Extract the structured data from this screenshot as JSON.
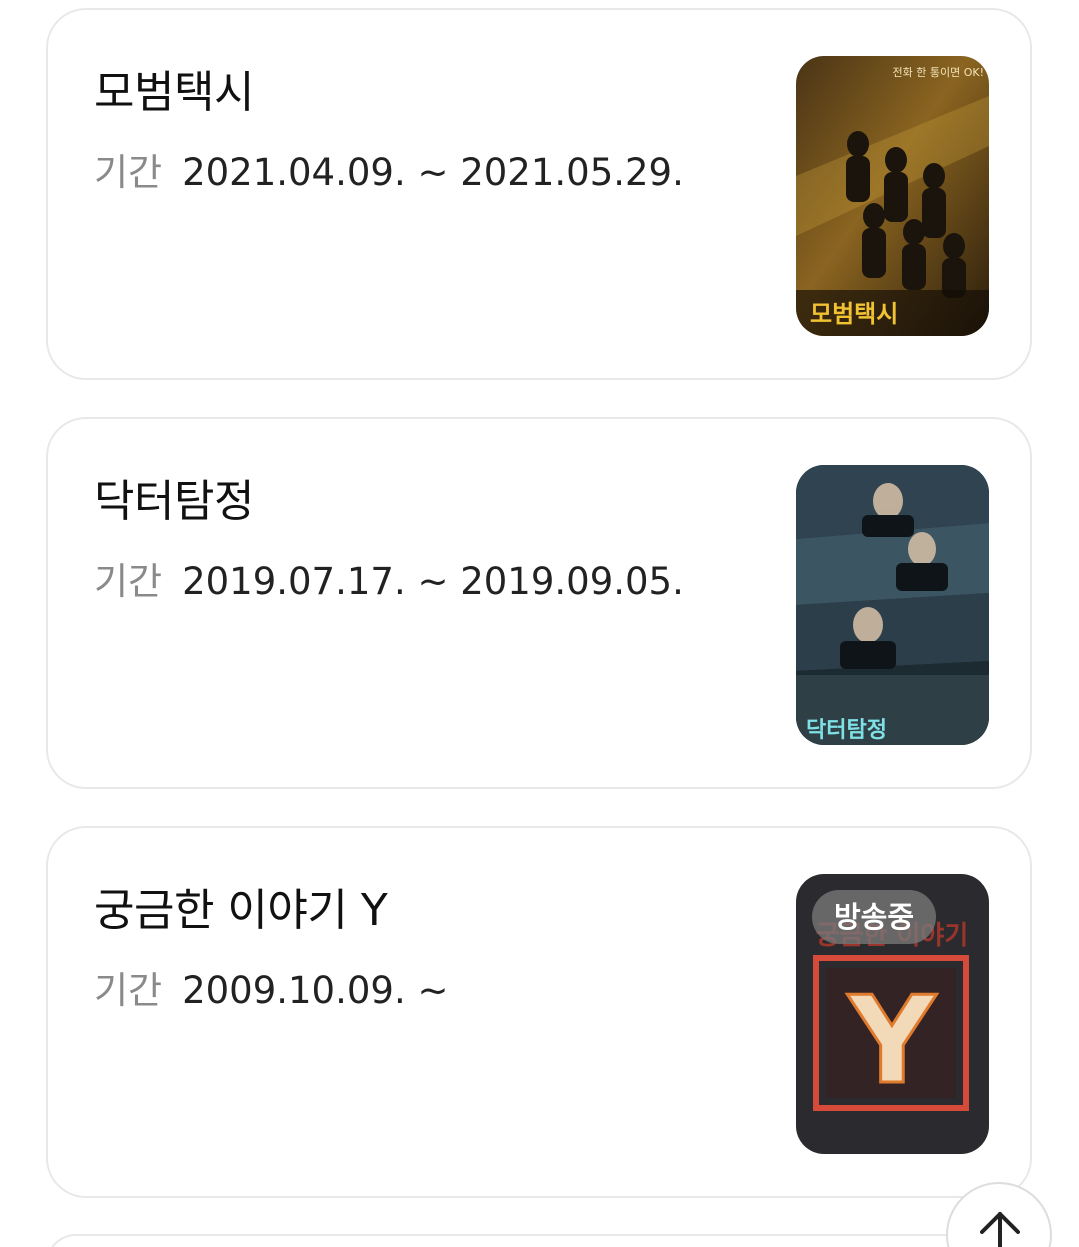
{
  "results": [
    {
      "title": "모범택시",
      "period_label": "기간",
      "period_value": "2021.04.09. ~ 2021.05.29.",
      "poster": {
        "caption": "모범택시",
        "tagline": "전화 한 통이면 OK!"
      }
    },
    {
      "title": "닥터탐정",
      "period_label": "기간",
      "period_value": "2019.07.17. ~ 2019.09.05.",
      "poster": {
        "caption": "닥터탐정"
      }
    },
    {
      "title": "궁금한 이야기 Y",
      "period_label": "기간",
      "period_value": "2009.10.09. ~",
      "poster": {
        "badge": "방송중",
        "logo_letter": "Y",
        "caption": "궁금한 이야기"
      }
    }
  ],
  "scroll_top": {
    "icon": "arrow-up-icon"
  },
  "colors": {
    "card_border": "#e8e8e8",
    "label_gray": "#8a8a8a",
    "text_dark": "#111111",
    "badge_bg": "#787878"
  }
}
